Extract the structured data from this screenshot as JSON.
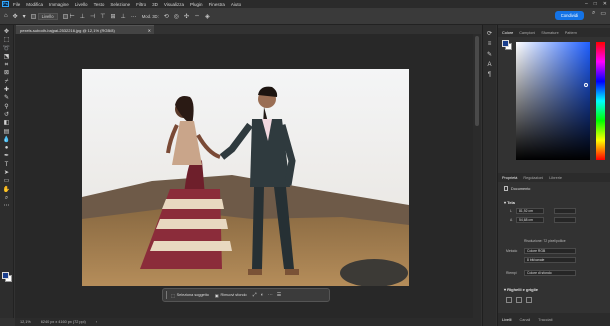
{
  "app": {
    "logo": "Ps",
    "menu": [
      "File",
      "Modifica",
      "Immagine",
      "Livello",
      "Testo",
      "Selezione",
      "Filtro",
      "3D",
      "Visualizza",
      "Plugin",
      "Finestra",
      "Aiuto"
    ]
  },
  "options_bar": {
    "layer_select": "Livello",
    "mode_label": "Mod. 3D:",
    "share_label": "Condividi"
  },
  "document": {
    "tab_title": "pexels-subodh-bajpai-2532216.jpg @ 12,1% (RGB/8)",
    "zoom": "12,1%",
    "info": "6240 px x 4160 px (72 ppi)"
  },
  "taskbar": {
    "select_subject": "Seleziona soggetto",
    "remove_background": "Rimuovi sfondo"
  },
  "color_panel": {
    "tabs": [
      "Colore",
      "Campioni",
      "Sfumature",
      "Pattern"
    ],
    "foreground": "#1a3e8c",
    "background": "#ffffff"
  },
  "properties_panel": {
    "tabs": [
      "Proprietà",
      "Regolazioni",
      "Librerie"
    ],
    "doc_label": "Documento",
    "canvas_section": "Tela",
    "width_label": "L",
    "width_value": "81,92 cm",
    "height_label": "A",
    "height_value": "54,68 cm",
    "resolution": "Risoluzione: 72 pixel/pollice",
    "mode_label": "Metodo",
    "mode_value": "Colore RGB",
    "bits_value": "8 bit/canale",
    "fill_label": "Riempi",
    "fill_value": "Colore di sfondo",
    "rulers_section": "Righelli e griglie"
  },
  "bottom_tabs": [
    "Livelli",
    "Canali",
    "Tracciati"
  ]
}
